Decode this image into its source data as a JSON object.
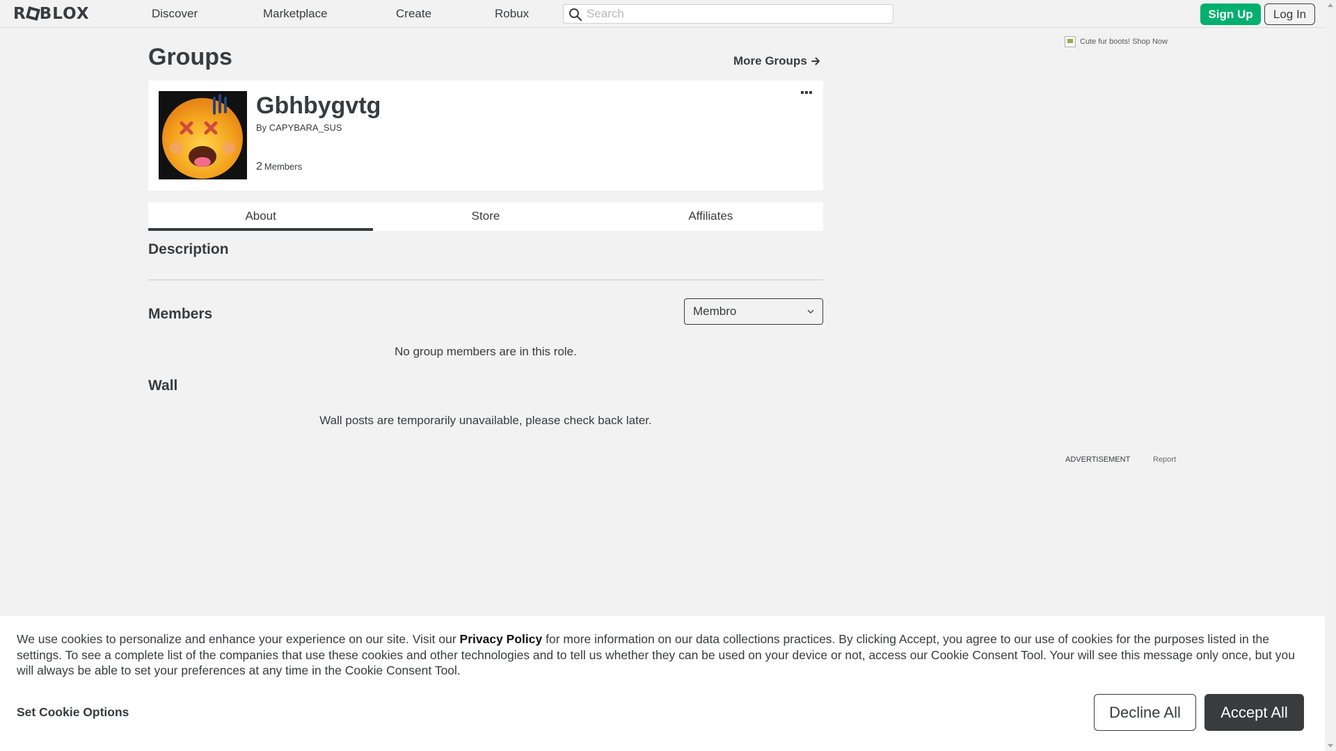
{
  "header": {
    "logo_text": "ROBLOX",
    "nav": [
      "Discover",
      "Marketplace",
      "Create",
      "Robux"
    ],
    "search_placeholder": "Search",
    "signup_label": "Sign Up",
    "login_label": "Log In"
  },
  "main": {
    "page_title": "Groups",
    "more_groups_label": "More Groups",
    "group": {
      "name": "Gbhbygvtg",
      "by_label": "By",
      "owner": "CAPYBARA_SUS",
      "member_count": "2",
      "members_label": "Members"
    },
    "tabs": [
      {
        "label": "About",
        "active": true
      },
      {
        "label": "Store",
        "active": false
      },
      {
        "label": "Affiliates",
        "active": false
      }
    ],
    "description_title": "Description",
    "members_title": "Members",
    "role_select_value": "Membro",
    "members_empty": "No group members are in this role.",
    "wall_title": "Wall",
    "wall_message": "Wall posts are temporarily unavailable, please check back later."
  },
  "ad": {
    "image_alt": "Cute fur boots! Shop Now",
    "label": "ADVERTISEMENT",
    "report": "Report"
  },
  "cookie_banner": {
    "text_before": "We use cookies to personalize and enhance your experience on our site. Visit our ",
    "privacy_link": "Privacy Policy",
    "text_after": " for more information on our data collections practices. By clicking Accept, you agree to our use of cookies for the purposes listed in the settings. To see a complete list of the companies that use these cookies and other technologies and to tell us whether they can be used on your device or not, access our Cookie Consent Tool. Your will see this message only once, but you will always be able to set your preferences at any time in the Cookie Consent Tool.",
    "set_options_label": "Set Cookie Options",
    "decline_label": "Decline All",
    "accept_label": "Accept All"
  },
  "colors": {
    "brand_green": "#00b06f",
    "text_dark": "#393b3d",
    "background": "#f2f2f2"
  }
}
